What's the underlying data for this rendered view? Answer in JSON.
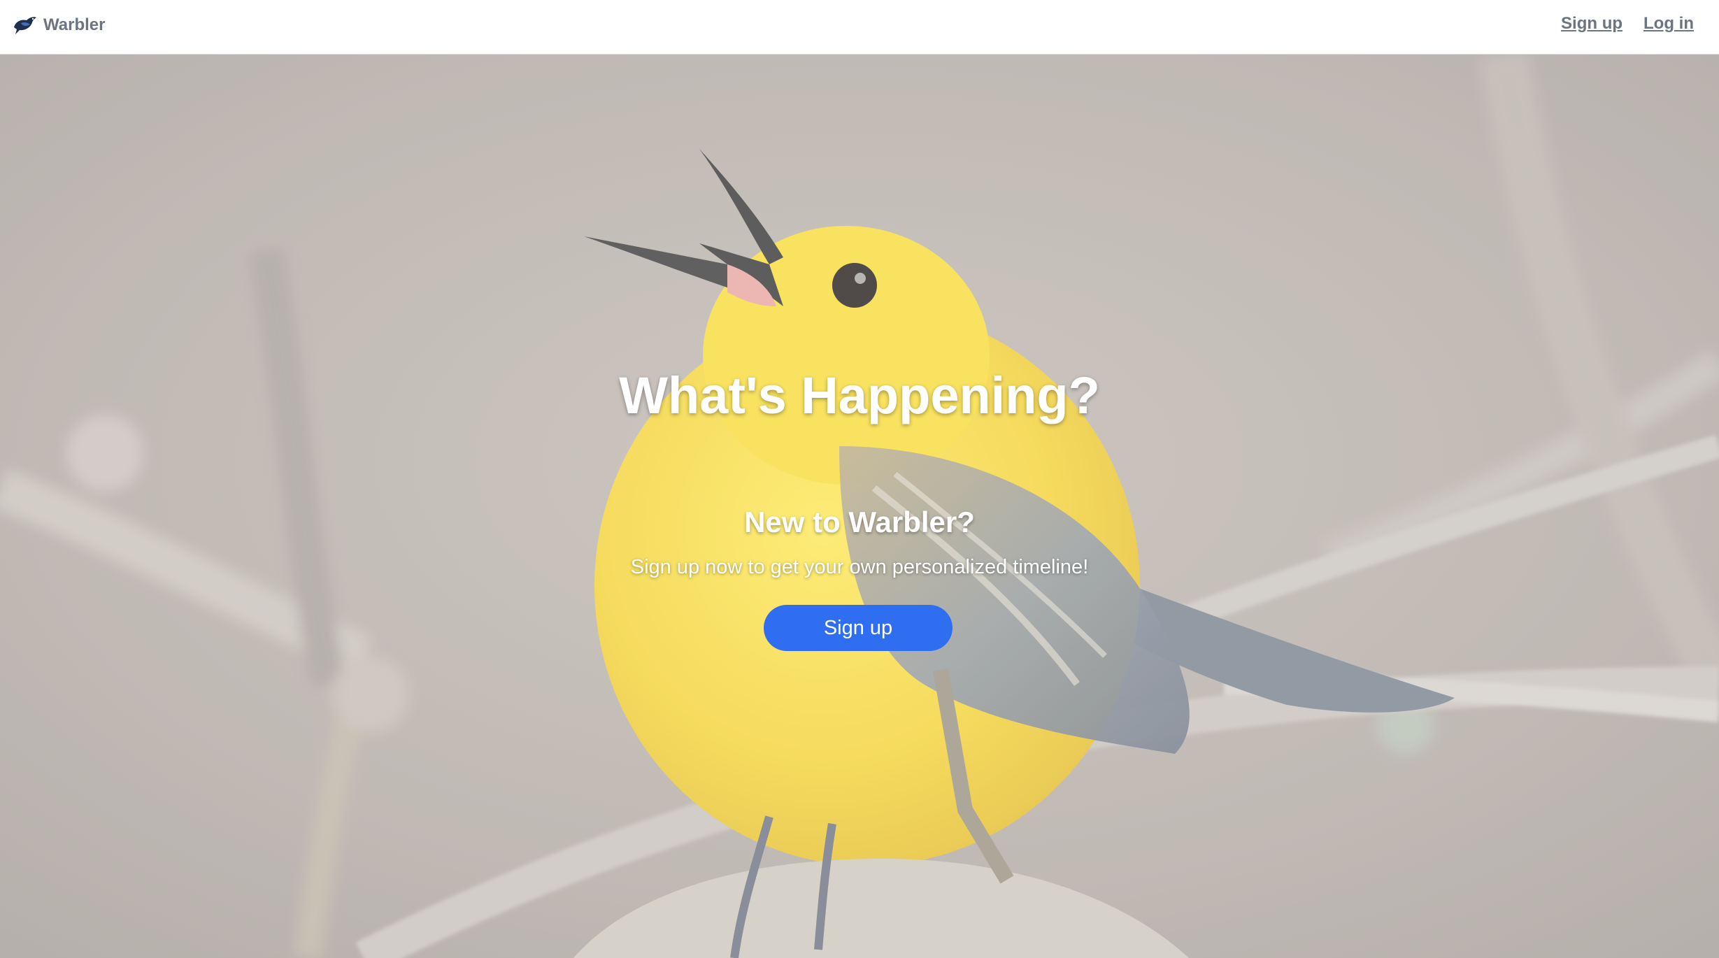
{
  "navbar": {
    "brand_name": "Warbler",
    "brand_icon": "warbler-bird-logo-icon",
    "links": {
      "signup": "Sign up",
      "login": "Log in"
    }
  },
  "hero": {
    "background": "yellow-warbler-singing-photo",
    "title": "What's Happening?",
    "subtitle": "New to Warbler?",
    "text": "Sign up now to get your own personalized timeline!",
    "button_label": "Sign up"
  },
  "colors": {
    "accent": "#2f6ef0",
    "nav_text": "#6b7480",
    "bird_yellow": "#f6d63a"
  }
}
